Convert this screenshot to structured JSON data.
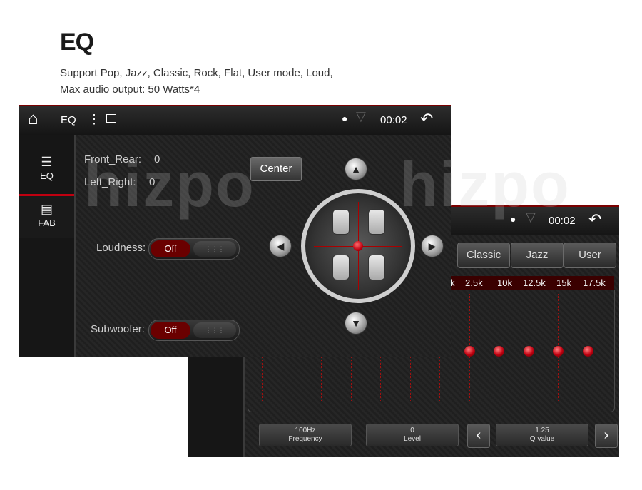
{
  "header": {
    "title": "EQ",
    "line1": "Support Pop, Jazz, Classic, Rock, Flat, User mode,  Loud,",
    "line2": "Max audio output: 50 Watts*4"
  },
  "watermark": "hizpo",
  "front": {
    "statusbar": {
      "title": "EQ",
      "time": "00:02"
    },
    "sidebar": [
      {
        "label": "EQ",
        "icon": "eq-sliders-icon",
        "active": false
      },
      {
        "label": "FAB",
        "icon": "fab-bars-icon",
        "active": true
      }
    ],
    "front_rear_label": "Front_Rear:",
    "front_rear_value": "0",
    "left_right_label": "Left_Right:",
    "left_right_value": "0",
    "center_label": "Center",
    "loudness_label": "Loudness:",
    "loudness_value": "Off",
    "subwoofer_label": "Subwoofer:",
    "subwoofer_value": "Off"
  },
  "back": {
    "statusbar": {
      "time": "00:02"
    },
    "presets": [
      "Classic",
      "Jazz",
      "User"
    ],
    "freq_labels": [
      "k",
      "2.5k",
      "10k",
      "12.5k",
      "15k",
      "17.5k"
    ],
    "frequency_value": "100Hz",
    "frequency_label": "Frequency",
    "level_value": "0",
    "level_label": "Level",
    "q_value": "1.25",
    "q_label": "Q value"
  },
  "colors": {
    "accent": "#c00010",
    "bar": "#3a0000",
    "background": "#1e1e1e"
  }
}
